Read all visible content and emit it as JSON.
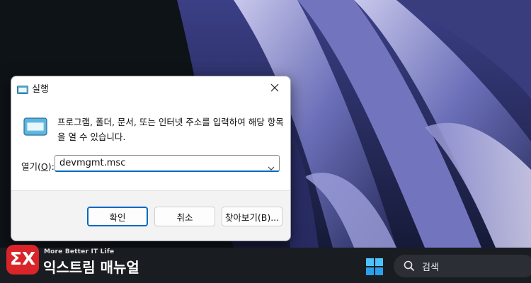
{
  "dialog": {
    "title": "실행",
    "description": "프로그램, 폴더, 문서, 또는 인터넷 주소를 입력하여 해당 항목을 열 수 있습니다.",
    "open_label_prefix": "열기(",
    "open_label_key": "O",
    "open_label_suffix": "):",
    "input_value": "devmgmt.msc",
    "buttons": {
      "ok": "확인",
      "cancel": "취소",
      "browse": "찾아보기(B)..."
    }
  },
  "taskbar": {
    "search_text": "검색"
  },
  "watermark": {
    "badge": "ΣX",
    "tagline": "More Better IT Life",
    "name": "익스트림 매뉴얼"
  },
  "colors": {
    "accent": "#0067c0",
    "taskbar_bg": "#191d22",
    "brand_red": "#d9242a",
    "wallpaper_purple": "#5a5fa8"
  }
}
